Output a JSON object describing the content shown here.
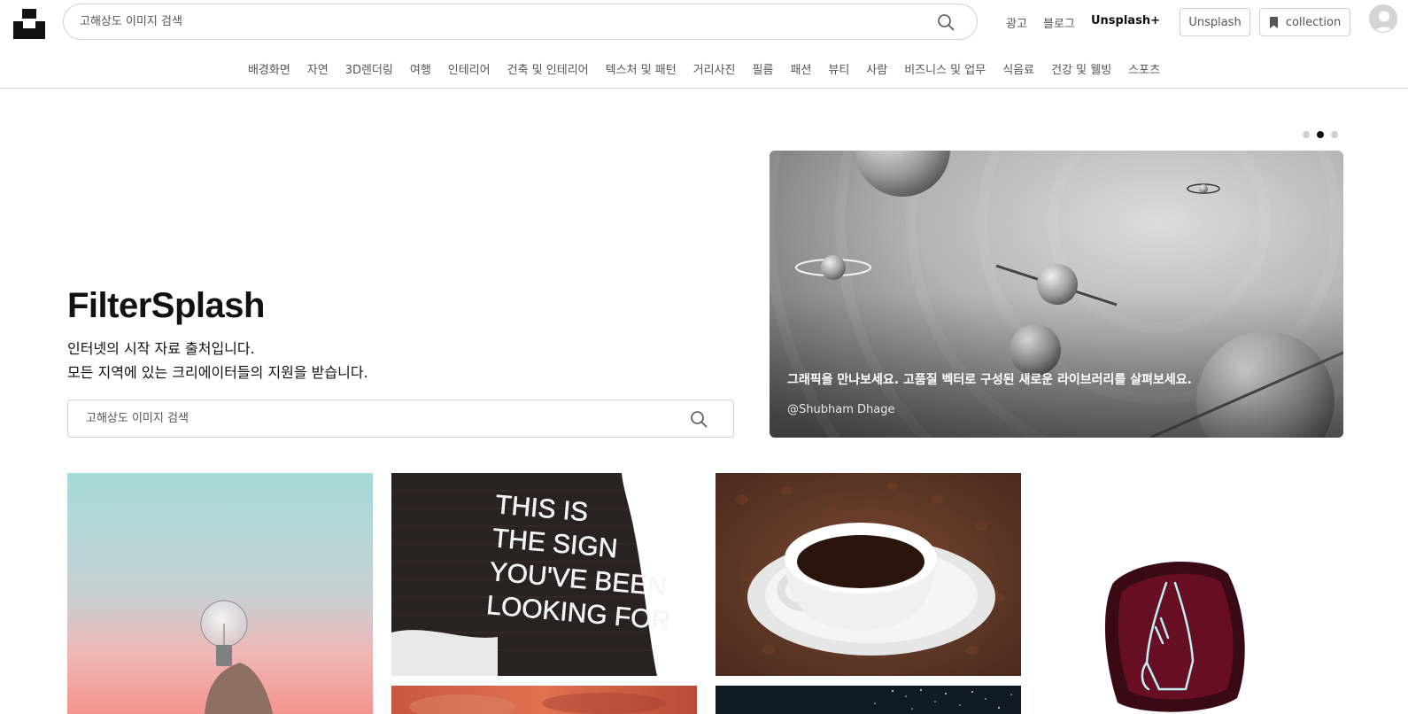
{
  "header": {
    "logo_icon": "unsplash-logo-icon",
    "search": {
      "placeholder": "고해상도 이미지 검색",
      "value": ""
    },
    "links": {
      "ads": "광고",
      "blog": "블로그",
      "plus": "Unsplash+"
    },
    "buttons": {
      "unsplash": "Unsplash",
      "collection": "collection"
    },
    "collection_icon": "bookmark-icon",
    "avatar_icon": "user-avatar-icon"
  },
  "categories": [
    "배경화면",
    "자연",
    "3D렌더링",
    "여행",
    "인테리어",
    "건축 및 인테리어",
    "텍스처 및 패턴",
    "거리사진",
    "필름",
    "패션",
    "뷰티",
    "사람",
    "비즈니스 및 업무",
    "식음료",
    "건강 및 웰빙",
    "스포츠"
  ],
  "hero": {
    "title": "FilterSplash",
    "subtitle_line1": "인터넷의 시작 자료 출처입니다.",
    "subtitle_line2": "모든 지역에 있는 크리에이터들의 지원을 받습니다.",
    "search": {
      "placeholder": "고해상도 이미지 검색",
      "value": ""
    }
  },
  "carousel": {
    "active_index": 1,
    "count": 3,
    "caption": "그래픽을 만나보세요. 고품질 벡터로 구성된 새로운 라이브러리를 살펴보세요.",
    "credit": "@Shubham Dhage"
  },
  "photos": [
    {
      "subject": "light bulb held against pastel sky"
    },
    {
      "subject": "neon sign: THIS IS THE SIGN YOU'VE BEEN LOOKING FOR",
      "neon_text": [
        "THIS IS",
        "THE SIGN",
        "YOU'VE BEEN",
        "LOOKING FOR"
      ]
    },
    {
      "subject": "coffee cup on coffee beans"
    },
    {
      "subject": "neon praying hands"
    },
    {
      "subject": "red clouds"
    },
    {
      "subject": "night sky stars"
    }
  ],
  "colors": {
    "text": "#111111",
    "muted": "#555555",
    "border": "#d1d1d1",
    "neon_pink": "#c2185b"
  }
}
